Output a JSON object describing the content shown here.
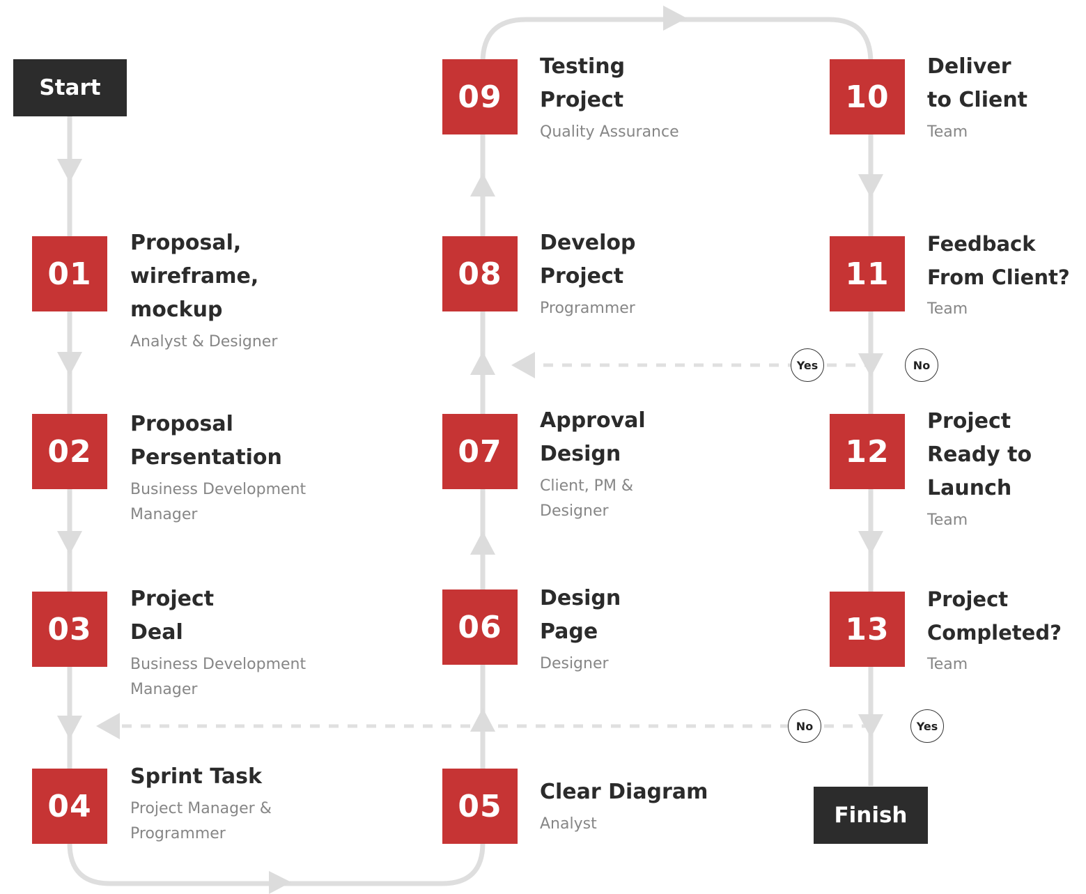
{
  "colors": {
    "accent": "#c63434",
    "terminal": "#2c2c2c",
    "connector": "#dedede",
    "title_text": "#2b2b2b",
    "role_text": "#868686"
  },
  "start_label": "Start",
  "finish_label": "Finish",
  "steps": [
    {
      "number": "01",
      "title": "Proposal,\nwireframe,\nmockup",
      "role": "Analyst & Designer"
    },
    {
      "number": "02",
      "title": "Proposal\nPersentation",
      "role": "Business Development\nManager"
    },
    {
      "number": "03",
      "title": "Project\nDeal",
      "role": "Business Development\nManager"
    },
    {
      "number": "04",
      "title": "Sprint Task",
      "role": "Project Manager &\nProgrammer"
    },
    {
      "number": "05",
      "title": "Clear Diagram",
      "role": "Analyst"
    },
    {
      "number": "06",
      "title": "Design\nPage",
      "role": "Designer"
    },
    {
      "number": "07",
      "title": "Approval\nDesign",
      "role": "Client, PM &\nDesigner"
    },
    {
      "number": "08",
      "title": "Develop\nProject",
      "role": "Programmer"
    },
    {
      "number": "09",
      "title": "Testing\nProject",
      "role": "Quality Assurance"
    },
    {
      "number": "10",
      "title": "Deliver\nto Client",
      "role": "Team"
    },
    {
      "number": "11",
      "title": "Feedback\nFrom Client?",
      "role": "Team"
    },
    {
      "number": "12",
      "title": "Project\nReady to\nLaunch",
      "role": "Team"
    },
    {
      "number": "13",
      "title": "Project\nCompleted?",
      "role": "Team"
    }
  ],
  "decisions": {
    "feedback": {
      "yes": "Yes",
      "no": "No"
    },
    "completed": {
      "no": "No",
      "yes": "Yes"
    }
  }
}
